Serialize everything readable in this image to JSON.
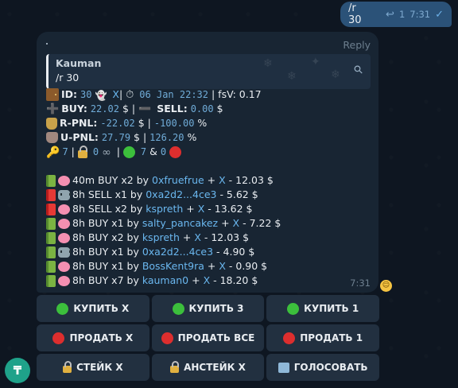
{
  "outgoing": {
    "text": "/r 30",
    "reply_count": "1",
    "time": "7:31"
  },
  "incoming": {
    "reply_label": "Reply",
    "quote_name": "Kauman",
    "quote_text": "/r 30",
    "id_label": "ID:",
    "id_value": "30",
    "id_x": "X",
    "id_sep1": "|",
    "date": "06 Jan 22:32",
    "fsv": "| fsV: 0.17",
    "buy_label": "BUY:",
    "buy_value": "22.02",
    "buy_unit": "$ |",
    "sell_label": "SELL:",
    "sell_value": "0.00",
    "sell_unit": "$",
    "rpnl_label": "R-PNL:",
    "rpnl_value": "-22.02",
    "rpnl_unit": "$ |",
    "rpnl_pct": "-100.00",
    "rpnl_pct_unit": "%",
    "upnl_label": "U-PNL:",
    "upnl_value": "27.79",
    "upnl_unit": "$ |",
    "upnl_pct": "126.20",
    "upnl_pct_unit": "%",
    "keys": "7",
    "sep2": "|",
    "locks": "0",
    "sep3": "|",
    "green_count": "7",
    "amp": "&",
    "red_count": "0",
    "time": "7:31",
    "trades": [
      {
        "book": "green",
        "icon": "brain",
        "pre": "40m BUY x2 by ",
        "user": "0xfruefrue",
        "plus": " + ",
        "x": "X",
        "post": " - 12.03 $"
      },
      {
        "book": "red",
        "icon": "robot",
        "pre": "8h SELL x1 by ",
        "user": "0xa2d2...4ce3",
        "plus": "",
        "x": "",
        "post": " - 5.62 $"
      },
      {
        "book": "red",
        "icon": "brain",
        "pre": "8h SELL x2 by ",
        "user": "kspreth",
        "plus": " + ",
        "x": "X",
        "post": " - 13.62 $"
      },
      {
        "book": "green",
        "icon": "brain",
        "pre": "8h BUY x1 by ",
        "user": "salty_pancakez",
        "plus": " + ",
        "x": "X",
        "post": " - 7.22 $"
      },
      {
        "book": "green",
        "icon": "brain",
        "pre": "8h BUY x2 by ",
        "user": "kspreth",
        "plus": " + ",
        "x": "X",
        "post": " - 12.03 $"
      },
      {
        "book": "green",
        "icon": "robot",
        "pre": "8h BUY x1 by ",
        "user": "0xa2d2...4ce3",
        "plus": "",
        "x": "",
        "post": " - 4.90 $"
      },
      {
        "book": "green",
        "icon": "brain",
        "pre": "8h BUY x1 by ",
        "user": "BossKent9ra",
        "plus": " + ",
        "x": "X",
        "post": " - 0.90 $"
      },
      {
        "book": "green",
        "icon": "brain",
        "pre": "8h BUY x7 by ",
        "user": "kauman0",
        "plus": " + ",
        "x": "X",
        "post": " - 18.20 $"
      }
    ]
  },
  "keyboard": {
    "buy_x": "КУПИТЬ X",
    "buy_3": "КУПИТЬ 3",
    "buy_1": "КУПИТЬ 1",
    "sell_x": "ПРОДАТЬ X",
    "sell_all": "ПРОДАТЬ ВСЕ",
    "sell_1": "ПРОДАТЬ 1",
    "stake_x": "СТЕЙК X",
    "unstake_x": "АНСТЕЙК X",
    "vote": "ГОЛОСОВАТЬ"
  },
  "icons": {
    "reply": "reply-icon",
    "check": "check-icon",
    "link": "link-icon"
  },
  "colors": {
    "link": "#6ab7ef",
    "mono": "#70acd8",
    "bubble_in": "#182533",
    "bubble_out": "#2b5278",
    "button": "#223040"
  }
}
